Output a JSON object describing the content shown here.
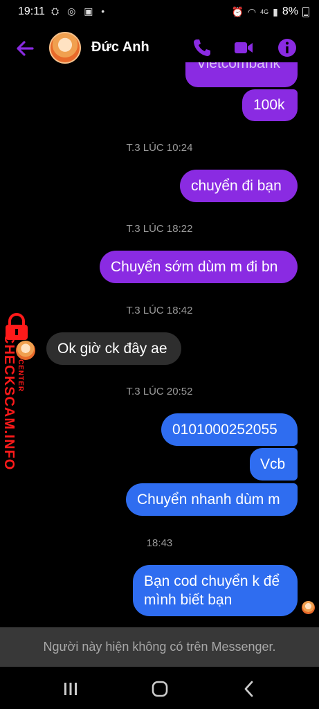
{
  "status_bar": {
    "time": "19:11",
    "left_icons": "⛭ ◎ ▣ •",
    "network": "4G",
    "battery": "8%"
  },
  "header": {
    "contact_name": "Đức Anh",
    "accent_color": "#8a2be2"
  },
  "messages": {
    "partial_top": "Vietcombank",
    "m1": "100k",
    "ts1": "T.3 LÚC 10:24",
    "m2": "chuyển đi bạn",
    "ts2": "T.3 LÚC 18:22",
    "m3": "Chuyển sớm dùm m đi bn",
    "ts3": "T.3 LÚC 18:42",
    "r1": "Ok giờ ck đây ae",
    "ts4": "T.3 LÚC 20:52",
    "m4": "0101000252055",
    "m5": "Vcb",
    "m6": "Chuyển nhanh dùm m",
    "ts5": "18:43",
    "m7_line1": "Bạn cod chuyển k để",
    "m7_line2": "mình biết bạn"
  },
  "watermark": {
    "text": "CHECKSCAM.INFO",
    "sub": "CENTER"
  },
  "footer": {
    "unavailable_text": "Người này hiện không có trên Messenger."
  }
}
